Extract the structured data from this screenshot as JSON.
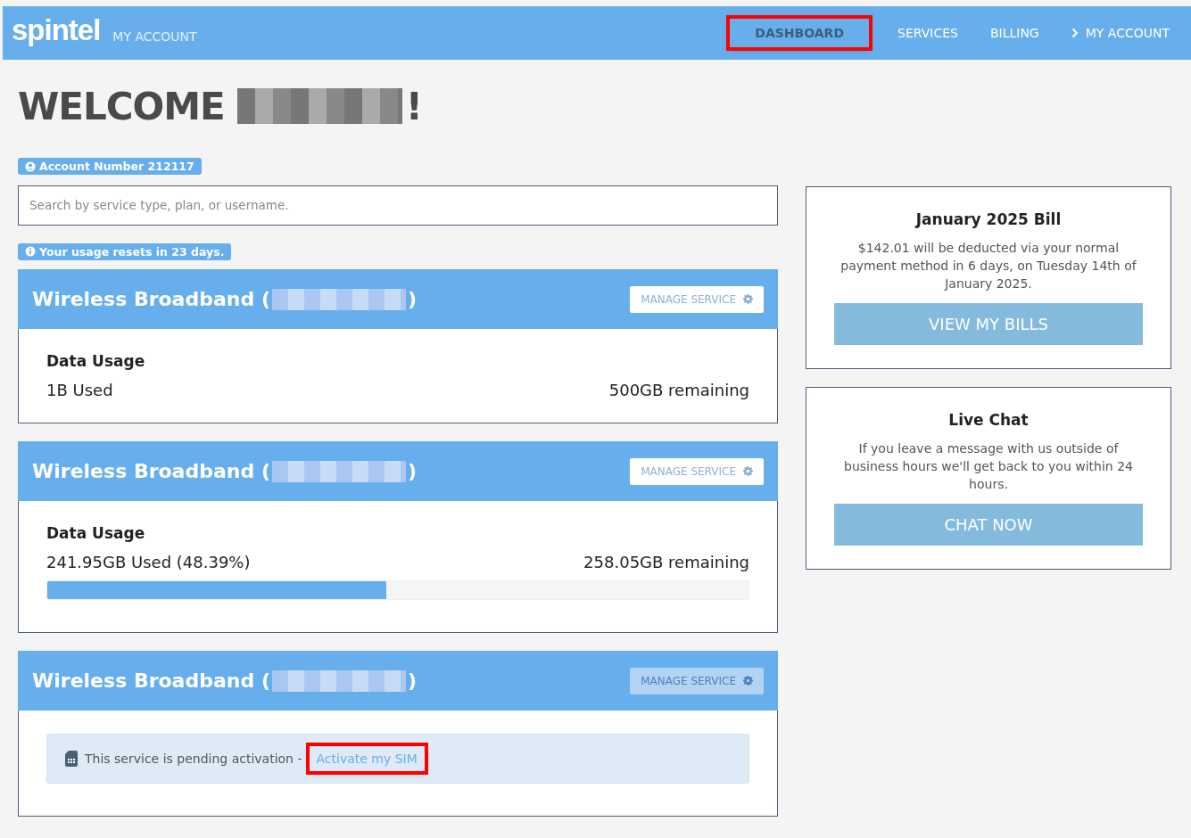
{
  "header": {
    "logo": "spintel",
    "subtitle": "MY ACCOUNT",
    "nav": [
      {
        "label": "DASHBOARD",
        "selected": true,
        "highlighted": true,
        "chevron": false
      },
      {
        "label": "SERVICES",
        "selected": false,
        "highlighted": false,
        "chevron": false
      },
      {
        "label": "BILLING",
        "selected": false,
        "highlighted": false,
        "chevron": false
      },
      {
        "label": "MY ACCOUNT",
        "selected": false,
        "highlighted": false,
        "chevron": true
      }
    ]
  },
  "welcome": {
    "prefix": "WELCOME",
    "suffix": "!",
    "redacted": true
  },
  "account_badge": "Account Number 212117",
  "search": {
    "placeholder": "Search by service type, plan, or username."
  },
  "usage_badge": "Your usage resets in 23 days.",
  "services": [
    {
      "title_start": "Wireless Broadband (",
      "title_end": ")",
      "manage": "MANAGE SERVICE",
      "manage_disabled": false,
      "kind": "usage",
      "heading": "Data Usage",
      "used": "1B Used",
      "remaining": "500GB remaining"
    },
    {
      "title_start": "Wireless Broadband (",
      "title_end": ")",
      "manage": "MANAGE SERVICE",
      "manage_disabled": false,
      "kind": "usage",
      "heading": "Data Usage",
      "used": "241.95GB Used (48.39%)",
      "remaining": "258.05GB remaining",
      "level": 0.4839
    },
    {
      "title_start": "Wireless Broadband (",
      "title_end": ")",
      "manage": "MANAGE SERVICE",
      "manage_disabled": true,
      "kind": "pending",
      "notice": "This service is pending activation -",
      "link": "Activate my SIM",
      "link_highlighted": true
    }
  ],
  "panels": [
    {
      "title": "January 2025 Bill",
      "text": "$142.01 will be deducted via your normal payment method in 6 days, on Tuesday 14th of January 2025.",
      "button": "VIEW MY BILLS"
    },
    {
      "title": "Live Chat",
      "text": "If you leave a message with us outside of business hours we'll get back to you within 24 hours.",
      "button": "CHAT NOW"
    }
  ]
}
